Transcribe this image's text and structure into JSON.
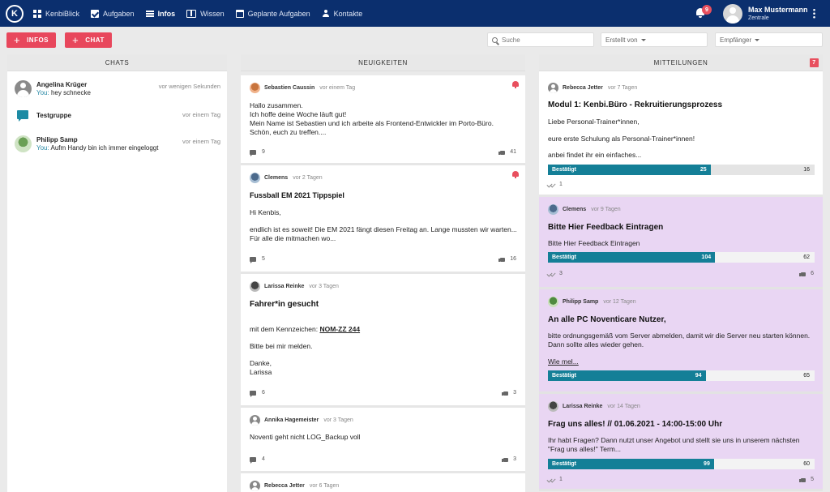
{
  "nav": {
    "logo": "K",
    "items": [
      {
        "label": "KenbiBlick",
        "icon": "dashboard-icon"
      },
      {
        "label": "Aufgaben",
        "icon": "checkbox-icon"
      },
      {
        "label": "Infos",
        "icon": "list-icon",
        "active": true
      },
      {
        "label": "Wissen",
        "icon": "book-icon"
      },
      {
        "label": "Geplante Aufgaben",
        "icon": "calendar-icon"
      },
      {
        "label": "Kontakte",
        "icon": "person-icon"
      }
    ],
    "notification_count": "9",
    "user_name": "Max Mustermann",
    "user_location": "Zentrale"
  },
  "toolbar": {
    "infos_label": "INFOS",
    "chat_label": "CHAT",
    "plus": "+",
    "search_placeholder": "Suche",
    "created_by": "Erstellt von",
    "recipient": "Empfänger"
  },
  "chats": {
    "title": "CHATS",
    "items": [
      {
        "name": "Angelina Krüger",
        "you": "You:",
        "message": "hey schnecke",
        "time": "vor wenigen Sekunden"
      },
      {
        "name": "Testgruppe",
        "you": "",
        "message": "",
        "time": "vor einem Tag"
      },
      {
        "name": "Philipp Samp",
        "you": "You:",
        "message": "Aufm Handy bin ich immer eingeloggt",
        "time": "vor einem Tag"
      }
    ]
  },
  "news": {
    "title": "NEUIGKEITEN",
    "posts": [
      {
        "author": "Sebastien Caussin",
        "time": "vor einem Tag",
        "text": "Hallo zusammen.\nIch hoffe deine Woche läuft gut!\nMein Name ist Sebastien und ich arbeite als Frontend-Entwickler im Porto-Büro.\nSchön, euch zu treffen....",
        "comments": "9",
        "likes": "41"
      },
      {
        "author": "Clemens",
        "time": "vor 2 Tagen",
        "title": "Fussball EM 2021 Tippspiel",
        "greeting": "Hi Kenbis,",
        "text": "endlich ist es soweit! Die EM 2021 fängt diesen Freitag an. Lange mussten wir warten... Für alle die mitmachen wo...",
        "comments": "5",
        "likes": "16"
      },
      {
        "author": "Larissa Reinke",
        "time": "vor 3 Tagen",
        "title": "Fahrer*in gesucht",
        "text_prefix": "mit dem Kennzeichen: ",
        "plate": "NOM-ZZ 244",
        "text2": "Bitte bei mir melden.",
        "text3": "Danke,\nLarissa",
        "comments": "6",
        "likes": "3"
      },
      {
        "author": "Annika Hagemeister",
        "time": "vor 3 Tagen",
        "text": "Noventi geht nicht LOG_Backup voll",
        "comments": "4",
        "likes": "3"
      },
      {
        "author": "Rebecca Jetter",
        "time": "vor 6 Tagen"
      }
    ]
  },
  "messages": {
    "title": "MITTEILUNGEN",
    "badge": "7",
    "items": [
      {
        "author": "Rebecca Jetter",
        "time": "vor 7 Tagen",
        "title": "Modul 1: Kenbi.Büro - Rekruitierungsprozess",
        "line1": "Liebe Personal-Trainer*innen,",
        "line2": "eure erste Schulung als Personal-Trainer*innen!",
        "line3": "anbei findet ihr ein einfaches...",
        "confirmed_label": "Bestätigt",
        "confirmed": 25,
        "pending": 16,
        "seen": "1"
      },
      {
        "author": "Clemens",
        "time": "vor 9 Tagen",
        "title": "Bitte Hier Feedback Eintragen",
        "line1": "Bitte Hier Feedback Eintragen",
        "confirmed_label": "Bestätigt",
        "confirmed": 104,
        "pending": 62,
        "seen": "3",
        "likes": "6"
      },
      {
        "author": "Philipp Samp",
        "time": "vor 12 Tagen",
        "title": "An alle PC Noventicare Nutzer,",
        "line1": "bitte ordnungsgemäß vom Server abmelden, damit wir die Server neu starten können. Dann sollte alles wieder gehen.",
        "more": "Wie mel...",
        "confirmed_label": "Bestätigt",
        "confirmed": 94,
        "pending": 65
      },
      {
        "author": "Larissa Reinke",
        "time": "vor 14 Tagen",
        "title": "Frag uns alles! // 01.06.2021 - 14:00-15:00 Uhr",
        "line1": "Ihr habt Fragen? Dann nutzt unser Angebot und stellt sie uns in unserem nächsten \"Frag uns alles!\" Term...",
        "confirmed_label": "Bestätigt",
        "confirmed": 99,
        "pending": 60,
        "seen": "1",
        "likes": "5"
      }
    ]
  },
  "colors": {
    "nav": "#0b2f6e",
    "accent": "#e8475c",
    "progress": "#147f97",
    "highlight": "#e9d6f3"
  }
}
